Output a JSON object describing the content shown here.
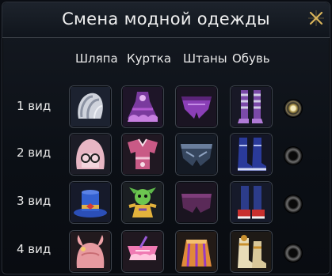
{
  "window": {
    "title": "Смена модной одежды"
  },
  "columns": [
    "Шляпа",
    "Куртка",
    "Штаны",
    "Обувь"
  ],
  "rows": [
    {
      "label": "1 вид",
      "selected": true,
      "items": [
        {
          "icon": "white-feathered-hat-icon"
        },
        {
          "icon": "purple-frilled-dress-icon"
        },
        {
          "icon": "purple-shorts-icon"
        },
        {
          "icon": "purple-striped-stockings-icon"
        }
      ]
    },
    {
      "label": "2 вид",
      "selected": false,
      "items": [
        {
          "icon": "pink-hood-with-glasses-icon"
        },
        {
          "icon": "pink-jester-jacket-icon"
        },
        {
          "icon": "dark-armored-shorts-icon"
        },
        {
          "icon": "blue-high-boots-icon"
        }
      ]
    },
    {
      "label": "3 вид",
      "selected": false,
      "items": [
        {
          "icon": "blue-top-hat-icon"
        },
        {
          "icon": "green-mascot-costume-icon"
        },
        {
          "icon": "plum-shorts-icon"
        },
        {
          "icon": "red-platform-boots-icon"
        }
      ]
    },
    {
      "label": "4 вид",
      "selected": false,
      "items": [
        {
          "icon": "pink-bunny-hood-icon"
        },
        {
          "icon": "pink-lace-top-icon"
        },
        {
          "icon": "orange-ribbon-skirt-icon"
        },
        {
          "icon": "cream-gold-boots-icon"
        }
      ]
    }
  ],
  "colors": {
    "background": "#0b0f15",
    "slot_border": "#3d434c",
    "text": "#e8e8e8",
    "radio_selected": "#c9b46a"
  }
}
